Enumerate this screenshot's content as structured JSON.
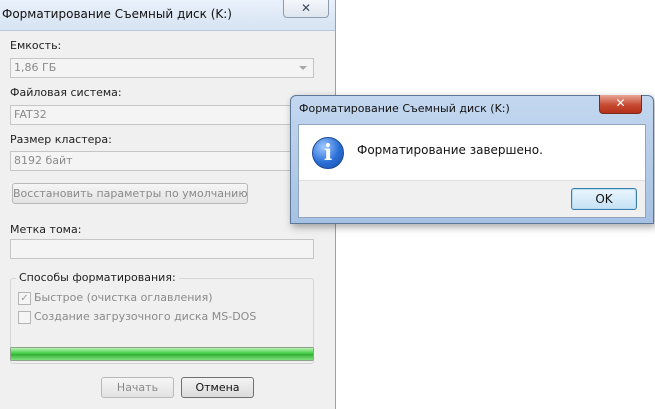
{
  "format_window": {
    "title": "Форматирование Съемный диск (K:)",
    "close_glyph": "✕",
    "capacity": {
      "label": "Емкость:",
      "value": "1,86 ГБ"
    },
    "file_system": {
      "label": "Файловая система:",
      "value": "FAT32"
    },
    "cluster_size": {
      "label": "Размер кластера:",
      "value": "8192 байт"
    },
    "restore_defaults_label": "Восстановить параметры по умолчанию",
    "volume_label": {
      "label": "Метка тома:",
      "value": ""
    },
    "format_options": {
      "legend": "Способы форматирования:",
      "quick_format": {
        "label": "Быстрое (очистка оглавления)",
        "checked": true,
        "mark": "✓"
      },
      "msdos_boot": {
        "label": "Создание загрузочного диска MS-DOS",
        "checked": false,
        "mark": ""
      }
    },
    "progress": {
      "fraction": 1.0
    },
    "start_label": "Начать",
    "cancel_label": "Отмена"
  },
  "message_box": {
    "title": "Форматирование Съемный диск (K:)",
    "close_glyph": "✕",
    "icon": "information-icon",
    "icon_glyph": "i",
    "message": "Форматирование завершено.",
    "ok_label": "OK"
  },
  "colors": {
    "progress_fill": "#35c93a",
    "title_bar": "#d6e3f2",
    "close_red": "#c74a32",
    "info_blue": "#2a6fd6"
  }
}
